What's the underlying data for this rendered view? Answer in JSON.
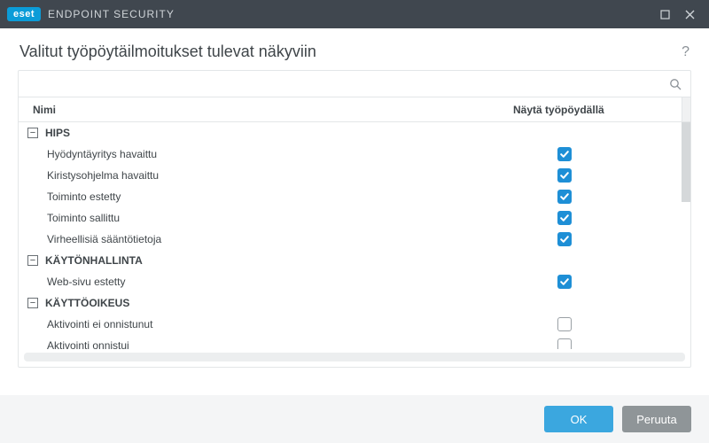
{
  "titlebar": {
    "brand_badge": "eset",
    "brand_text": "ENDPOINT SECURITY"
  },
  "heading": "Valitut työpöytäilmoitukset tulevat näkyviin",
  "columns": {
    "name": "Nimi",
    "show": "Näytä työpöydällä"
  },
  "search": {
    "placeholder": ""
  },
  "groups": [
    {
      "label": "HIPS",
      "items": [
        {
          "label": "Hyödyntäyritys havaittu",
          "checked": true
        },
        {
          "label": "Kiristysohjelma havaittu",
          "checked": true
        },
        {
          "label": "Toiminto estetty",
          "checked": true
        },
        {
          "label": "Toiminto sallittu",
          "checked": true
        },
        {
          "label": "Virheellisiä sääntötietoja",
          "checked": true
        }
      ]
    },
    {
      "label": "KÄYTÖNHALLINTA",
      "items": [
        {
          "label": "Web-sivu estetty",
          "checked": true
        }
      ]
    },
    {
      "label": "KÄYTTÖOIKEUS",
      "items": [
        {
          "label": "Aktivointi ei onnistunut",
          "checked": false
        },
        {
          "label": "Aktivointi onnistui",
          "checked": false
        }
      ]
    }
  ],
  "footer": {
    "ok": "OK",
    "cancel": "Peruuta"
  }
}
